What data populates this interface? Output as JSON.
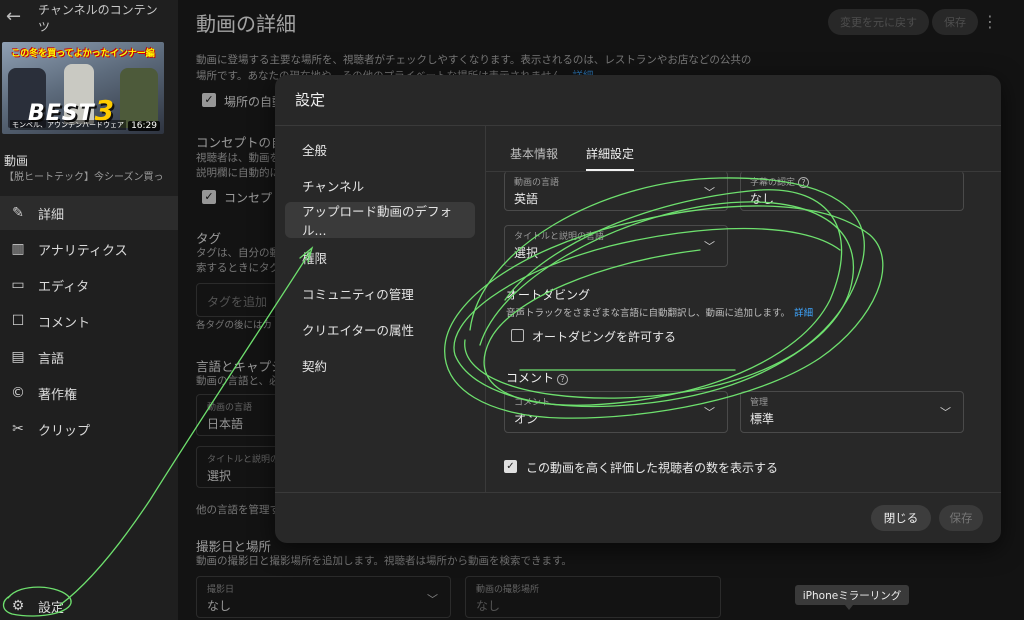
{
  "sidebar": {
    "back_title": "チャンネルのコンテンツ",
    "thumb_banner": "この冬を買ってよかったインナー編",
    "thumb_best": "BEST",
    "thumb_best_num": "3",
    "thumb_sub": "モンベル、アウンテンハードウェア",
    "duration": "16:29",
    "video_label": "動画",
    "video_title": "【脱ヒートテック】今シーズン買っ…",
    "items": [
      {
        "label": "詳細",
        "icon": "pencil-icon"
      },
      {
        "label": "アナリティクス",
        "icon": "analytics-icon"
      },
      {
        "label": "エディタ",
        "icon": "editor-icon"
      },
      {
        "label": "コメント",
        "icon": "comment-icon"
      },
      {
        "label": "言語",
        "icon": "subtitles-icon"
      },
      {
        "label": "著作権",
        "icon": "copyright-icon"
      },
      {
        "label": "クリップ",
        "icon": "scissors-icon"
      }
    ],
    "settings_label": "設定"
  },
  "main": {
    "title": "動画の詳細",
    "undo_label": "変更を元に戻す",
    "save_label": "保存",
    "location_desc_1": "動画に登場する主要な場所を、視聴者がチェックしやすくなります。表示されるのは、レストランやお店などの公共の",
    "location_desc_2": "場所です。あなたの現在地や、その他のプライベートな場所は表示されません。",
    "location_link": "詳細",
    "location_check": "場所の自動",
    "concept_heading": "コンセプトの自",
    "concept_desc_1": "視聴者は、動画を",
    "concept_desc_2": "説明欄に自動的に",
    "concept_check": "コンセプト",
    "tags_heading": "タグ",
    "tags_desc_1": "タグは、自分の動",
    "tags_desc_2": "索するときにタグ",
    "tags_placeholder": "タグを追加",
    "tags_hint": "各タグの後にはカ",
    "lang_heading": "言語とキャプショ",
    "lang_desc": "動画の言語と、必",
    "video_lang_label": "動画の言語",
    "video_lang_value": "日本語",
    "title_lang_label": "タイトルと説明の",
    "title_lang_value": "選択",
    "other_lang": "他の言語を管理す",
    "shoot_heading": "撮影日と場所",
    "shoot_desc": "動画の撮影日と撮影場所を追加します。視聴者は場所から動画を検索できます。",
    "shoot_date_label": "撮影日",
    "shoot_date_value": "なし",
    "shoot_place_label": "動画の撮影場所",
    "shoot_place_value": "なし"
  },
  "modal": {
    "title": "設定",
    "menu": [
      "全般",
      "チャンネル",
      "アップロード動画のデフォル...",
      "権限",
      "コミュニティの管理",
      "クリエイターの属性",
      "契約"
    ],
    "tabs": [
      "基本情報",
      "詳細設定"
    ],
    "video_lang_label": "動画の言語",
    "video_lang_value": "英語",
    "caption_label": "字幕の認定",
    "caption_value": "なし",
    "title_lang_label": "タイトルと説明の言語",
    "title_lang_value": "選択",
    "dub_heading": "オートダビング",
    "dub_desc": "音声トラックをさまざまな言語に自動翻訳し、動画に追加します。",
    "dub_link": "詳細",
    "dub_check_label": "オートダビングを許可する",
    "comments_heading": "コメント",
    "comments_label": "コメント",
    "comments_value": "オン",
    "manage_label": "管理",
    "manage_value": "標準",
    "likes_label": "この動画を高く評価した視聴者の数を表示する",
    "close_label": "閉じる",
    "save_label": "保存"
  },
  "tooltip": "iPhoneミラーリング",
  "colors": {
    "background": "#1c1c1c",
    "modal": "#282828",
    "link": "#3ea6ff",
    "annotation": "#6ee06e"
  }
}
